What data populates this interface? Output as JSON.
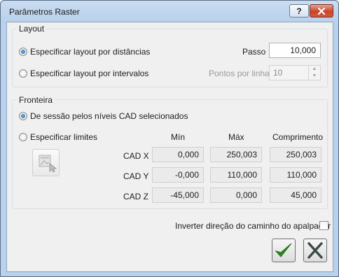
{
  "window": {
    "title": "Parâmetros Raster",
    "help_glyph": "?",
    "close_glyph": "✕"
  },
  "layout": {
    "group_label": "Layout",
    "option_distances": "Especificar layout por distâncias",
    "option_intervals": "Especificar layout por intervalos",
    "passo_label": "Passo",
    "passo_value": "10,000",
    "pontos_label": "Pontos por linha",
    "pontos_value": "10",
    "selected": "distances"
  },
  "boundary": {
    "group_label": "Fronteira",
    "option_session": "De sessão pelos níveis CAD selecionados",
    "option_limits": "Especificar limites",
    "selected": "session",
    "columns": [
      "Mín",
      "Máx",
      "Comprimento"
    ],
    "rows": [
      {
        "label": "CAD X",
        "min": "0,000",
        "max": "250,003",
        "length": "250,003"
      },
      {
        "label": "CAD Y",
        "min": "-0,000",
        "max": "110,000",
        "length": "110,000"
      },
      {
        "label": "CAD Z",
        "min": "-45,000",
        "max": "0,000",
        "length": "45,000"
      }
    ]
  },
  "options": {
    "invert_label": "Inverter direção do caminho do apalpador",
    "invert_checked": false
  },
  "colors": {
    "accept_green": "#2e8b1e",
    "cancel_dark": "#3a4a44",
    "close_red": "#c9452b",
    "selected_radio": "#1f5fa8"
  },
  "icons": {
    "accept": "checkmark-icon",
    "cancel": "x-icon",
    "pick_limits": "select-region-icon"
  }
}
